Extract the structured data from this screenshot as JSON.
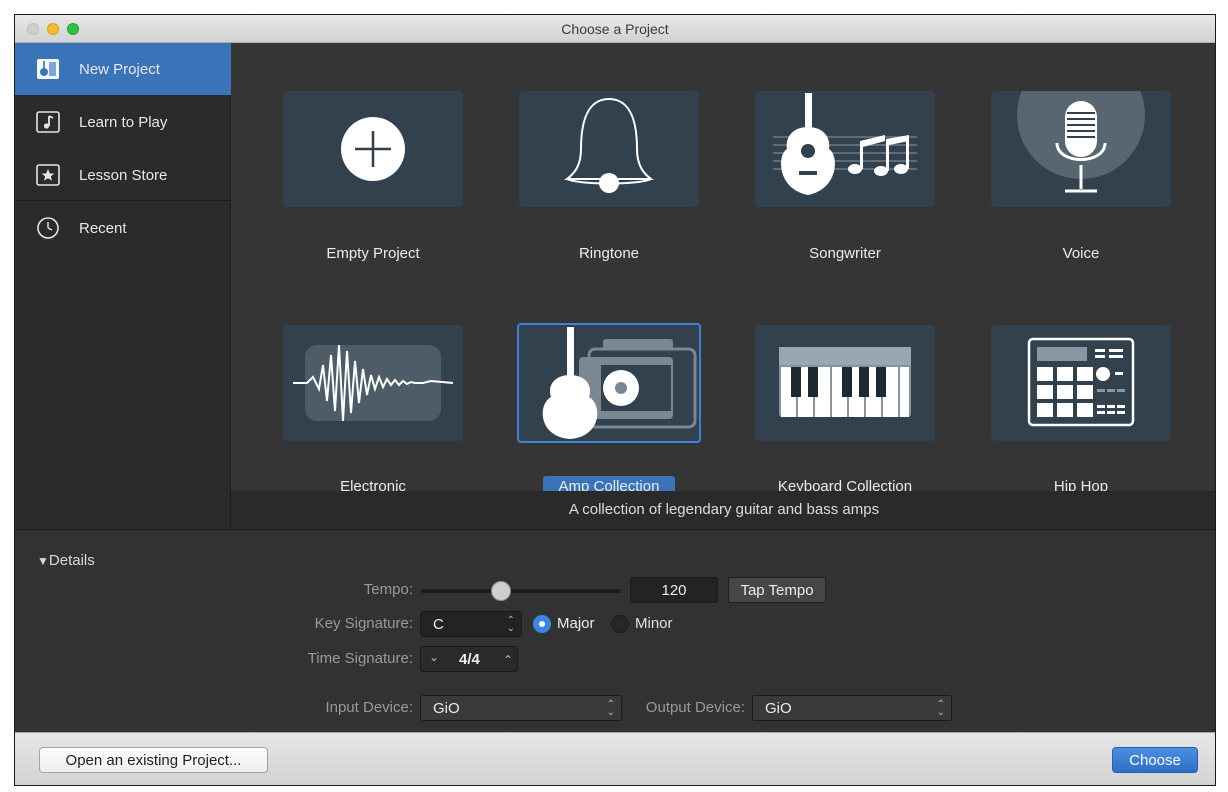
{
  "window": {
    "title": "Choose a Project"
  },
  "sidebar": {
    "items": [
      {
        "label": "New Project",
        "icon": "new-project-icon",
        "active": true
      },
      {
        "label": "Learn to Play",
        "icon": "music-note-icon",
        "active": false
      },
      {
        "label": "Lesson Store",
        "icon": "star-icon",
        "active": false
      },
      {
        "label": "Recent",
        "icon": "clock-icon",
        "active": false
      }
    ]
  },
  "templates": [
    {
      "label": "Empty Project",
      "icon": "plus-icon"
    },
    {
      "label": "Ringtone",
      "icon": "bell-icon"
    },
    {
      "label": "Songwriter",
      "icon": "guitar-notes-icon"
    },
    {
      "label": "Voice",
      "icon": "microphone-icon"
    },
    {
      "label": "Electronic",
      "icon": "waveform-icon"
    },
    {
      "label": "Amp Collection",
      "icon": "guitar-amp-icon",
      "selected": true
    },
    {
      "label": "Keyboard Collection",
      "icon": "keyboard-icon"
    },
    {
      "label": "Hip Hop",
      "icon": "drum-machine-icon"
    }
  ],
  "description": "A collection of legendary guitar and bass amps",
  "details": {
    "toggle_label": "Details",
    "tempo_label": "Tempo:",
    "tempo_value": "120",
    "tempo_slider_fraction": 0.4,
    "tap_tempo_label": "Tap Tempo",
    "key_signature_label": "Key Signature:",
    "key_value": "C",
    "major_label": "Major",
    "minor_label": "Minor",
    "time_signature_label": "Time Signature:",
    "time_value": "4/4",
    "input_device_label": "Input Device:",
    "input_device_value": "GiO",
    "output_device_label": "Output Device:",
    "output_device_value": "GiO"
  },
  "footer": {
    "open_label": "Open an existing Project...",
    "choose_label": "Choose"
  },
  "colors": {
    "accent": "#3a73b8",
    "tile_bg": "#31414d"
  }
}
